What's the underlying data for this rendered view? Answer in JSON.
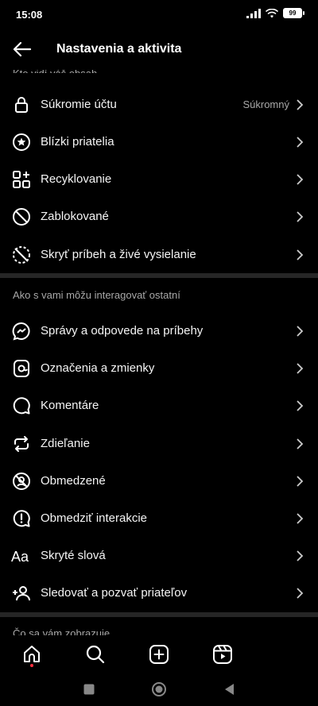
{
  "status_bar": {
    "time": "15:08",
    "battery": "99"
  },
  "header": {
    "title": "Nastavenia a aktivita"
  },
  "partial_section_header": "Kto vidí váš obsah",
  "section_privacy": {
    "items": [
      {
        "label": "Súkromie účtu",
        "value": "Súkromný",
        "icon": "lock-icon"
      },
      {
        "label": "Blízki priatelia",
        "icon": "close-friends-star-icon"
      },
      {
        "label": "Recyklovanie",
        "icon": "grid-plus-icon"
      },
      {
        "label": "Zablokované",
        "icon": "blocked-icon"
      },
      {
        "label": "Skryť príbeh a živé vysielanie",
        "icon": "hide-story-icon"
      }
    ]
  },
  "section_interactions": {
    "title": "Ako s vami môžu interagovať ostatní",
    "items": [
      {
        "label": "Správy a odpovede na príbehy",
        "icon": "messenger-icon"
      },
      {
        "label": "Označenia a zmienky",
        "icon": "at-icon"
      },
      {
        "label": "Komentáre",
        "icon": "comment-icon"
      },
      {
        "label": "Zdieľanie",
        "icon": "share-icon"
      },
      {
        "label": "Obmedzené",
        "icon": "restricted-icon"
      },
      {
        "label": "Obmedziť interakcie",
        "icon": "limit-interactions-icon"
      },
      {
        "label": "Skryté slová",
        "icon": "hidden-words-icon"
      },
      {
        "label": "Sledovať a pozvať priateľov",
        "icon": "follow-invite-icon"
      }
    ]
  },
  "partial_bottom_section_header": "Čo sa vám zobrazuje",
  "bottom_nav": [
    "home-icon",
    "search-icon",
    "create-icon",
    "reels-icon"
  ],
  "colors": {
    "background": "#000000",
    "text": "#f5f5f5",
    "secondary": "#a8a8a8",
    "divider": "#262626",
    "accent_dot": "#ff3040"
  }
}
